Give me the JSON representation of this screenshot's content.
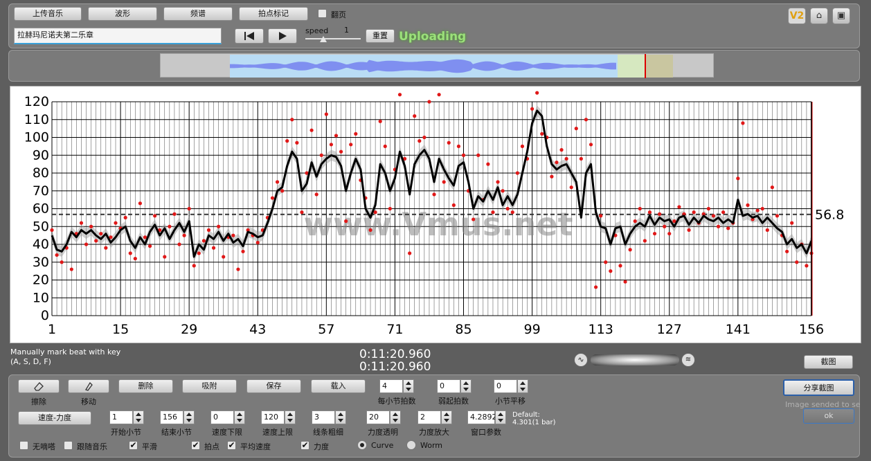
{
  "toolbar": {
    "upload_music": "上传音乐",
    "waveform": "波形",
    "spectrum": "频谱",
    "beat_mark": "拍点标记",
    "page_turn": "翻页",
    "song_title": "拉赫玛尼诺夫第二乐章",
    "speed_label": "speed",
    "speed_value": "1",
    "reset": "重置",
    "status": "Uploading",
    "v2_badge": "V2"
  },
  "info": {
    "hint_line1": "Manually mark beat with key",
    "hint_line2": "(A, S, D, F)",
    "time_current": "0:11:20.960",
    "time_total": "0:11:20.960",
    "screenshot": "截图",
    "share_screenshot": "分享截图",
    "sent_msg": "Image sended to sever",
    "ok": "ok"
  },
  "controls": {
    "erase": "擦除",
    "move": "移动",
    "delete": "删除",
    "snap": "吸附",
    "save": "保存",
    "load": "载入",
    "tempo_dynamics": "速度-力度",
    "beats_per_bar": {
      "value": "4",
      "label": "每小节拍数"
    },
    "pickup_beats": {
      "value": "0",
      "label": "弱起拍数"
    },
    "bar_shift": {
      "value": "0",
      "label": "小节平移"
    },
    "start_bar": {
      "value": "1",
      "label": "开始小节"
    },
    "end_bar": {
      "value": "156",
      "label": "结束小节"
    },
    "tempo_min": {
      "value": "0",
      "label": "速度下限"
    },
    "tempo_max": {
      "value": "120",
      "label": "速度上限"
    },
    "line_width": {
      "value": "3",
      "label": "线条粗细"
    },
    "dyn_opacity": {
      "value": "20",
      "label": "力度透明"
    },
    "dyn_scale": {
      "value": "2",
      "label": "力度放大"
    },
    "window_param": {
      "value": "4.2892",
      "label": "窗口参数"
    },
    "default_line1": "Default:",
    "default_line2": "4.301(1 bar)",
    "metronome": "无嘀嗒",
    "follow_music": "跟随音乐",
    "smooth": "平滑",
    "beat_points": "拍点",
    "avg_tempo": "平均速度",
    "dynamics": "力度",
    "curve": "Curve",
    "worm": "Worm"
  },
  "colors": {
    "bg": "#5e5e5e",
    "panel": "#7a7a7a",
    "accent_green": "#9be07a",
    "point_red": "#e01818",
    "curve_black": "#000000",
    "wave_blue": "#7f8ff0"
  },
  "chart_data": {
    "type": "scatter",
    "watermark": "www.Vmus.net",
    "xlim": [
      1,
      156
    ],
    "ylim": [
      0,
      120
    ],
    "xticks": [
      1,
      15,
      29,
      43,
      57,
      71,
      85,
      99,
      113,
      127,
      141,
      156
    ],
    "yticks": [
      0,
      10,
      20,
      30,
      40,
      50,
      60,
      70,
      80,
      90,
      100,
      110,
      120
    ],
    "average": 56.8,
    "average_label": "56.8",
    "curve": [
      [
        1,
        45
      ],
      [
        2,
        37
      ],
      [
        3,
        36
      ],
      [
        4,
        40
      ],
      [
        5,
        47
      ],
      [
        6,
        44
      ],
      [
        7,
        48
      ],
      [
        8,
        46
      ],
      [
        9,
        48
      ],
      [
        10,
        45
      ],
      [
        11,
        43
      ],
      [
        12,
        46
      ],
      [
        13,
        41
      ],
      [
        14,
        44
      ],
      [
        15,
        48
      ],
      [
        16,
        50
      ],
      [
        17,
        42
      ],
      [
        18,
        38
      ],
      [
        19,
        44
      ],
      [
        20,
        40
      ],
      [
        21,
        47
      ],
      [
        22,
        51
      ],
      [
        23,
        45
      ],
      [
        24,
        49
      ],
      [
        25,
        43
      ],
      [
        26,
        48
      ],
      [
        27,
        52
      ],
      [
        28,
        47
      ],
      [
        29,
        53
      ],
      [
        30,
        33
      ],
      [
        31,
        40
      ],
      [
        32,
        37
      ],
      [
        33,
        45
      ],
      [
        34,
        43
      ],
      [
        35,
        47
      ],
      [
        36,
        42
      ],
      [
        37,
        46
      ],
      [
        38,
        41
      ],
      [
        39,
        43
      ],
      [
        40,
        39
      ],
      [
        41,
        47
      ],
      [
        42,
        46
      ],
      [
        43,
        44
      ],
      [
        44,
        45
      ],
      [
        45,
        52
      ],
      [
        46,
        60
      ],
      [
        47,
        70
      ],
      [
        48,
        72
      ],
      [
        49,
        84
      ],
      [
        50,
        92
      ],
      [
        51,
        88
      ],
      [
        52,
        70
      ],
      [
        53,
        74
      ],
      [
        54,
        86
      ],
      [
        55,
        78
      ],
      [
        56,
        85
      ],
      [
        57,
        88
      ],
      [
        58,
        90
      ],
      [
        59,
        89
      ],
      [
        60,
        84
      ],
      [
        61,
        70
      ],
      [
        62,
        80
      ],
      [
        63,
        88
      ],
      [
        64,
        82
      ],
      [
        65,
        60
      ],
      [
        66,
        55
      ],
      [
        67,
        62
      ],
      [
        68,
        85
      ],
      [
        69,
        80
      ],
      [
        70,
        70
      ],
      [
        71,
        77
      ],
      [
        72,
        92
      ],
      [
        73,
        84
      ],
      [
        74,
        68
      ],
      [
        75,
        85
      ],
      [
        76,
        90
      ],
      [
        77,
        93
      ],
      [
        78,
        88
      ],
      [
        79,
        75
      ],
      [
        80,
        88
      ],
      [
        81,
        82
      ],
      [
        82,
        77
      ],
      [
        83,
        73
      ],
      [
        84,
        84
      ],
      [
        85,
        86
      ],
      [
        86,
        75
      ],
      [
        87,
        60
      ],
      [
        88,
        67
      ],
      [
        89,
        64
      ],
      [
        90,
        70
      ],
      [
        91,
        65
      ],
      [
        92,
        72
      ],
      [
        93,
        62
      ],
      [
        94,
        67
      ],
      [
        95,
        62
      ],
      [
        96,
        68
      ],
      [
        97,
        80
      ],
      [
        98,
        92
      ],
      [
        99,
        108
      ],
      [
        100,
        115
      ],
      [
        101,
        112
      ],
      [
        102,
        95
      ],
      [
        103,
        85
      ],
      [
        104,
        82
      ],
      [
        105,
        84
      ],
      [
        106,
        85
      ],
      [
        107,
        80
      ],
      [
        108,
        75
      ],
      [
        109,
        55
      ],
      [
        110,
        80
      ],
      [
        111,
        85
      ],
      [
        112,
        58
      ],
      [
        113,
        50
      ],
      [
        114,
        49
      ],
      [
        115,
        40
      ],
      [
        116,
        49
      ],
      [
        117,
        50
      ],
      [
        118,
        40
      ],
      [
        119,
        46
      ],
      [
        120,
        50
      ],
      [
        121,
        52
      ],
      [
        122,
        50
      ],
      [
        123,
        56
      ],
      [
        124,
        51
      ],
      [
        125,
        55
      ],
      [
        126,
        53
      ],
      [
        127,
        54
      ],
      [
        128,
        50
      ],
      [
        129,
        55
      ],
      [
        130,
        56
      ],
      [
        131,
        51
      ],
      [
        132,
        55
      ],
      [
        133,
        52
      ],
      [
        134,
        56
      ],
      [
        135,
        54
      ],
      [
        136,
        53
      ],
      [
        137,
        55
      ],
      [
        138,
        52
      ],
      [
        139,
        54
      ],
      [
        140,
        52
      ],
      [
        141,
        65
      ],
      [
        142,
        56
      ],
      [
        143,
        57
      ],
      [
        144,
        55
      ],
      [
        145,
        56
      ],
      [
        146,
        52
      ],
      [
        147,
        55
      ],
      [
        148,
        52
      ],
      [
        149,
        49
      ],
      [
        150,
        47
      ],
      [
        151,
        40
      ],
      [
        152,
        43
      ],
      [
        153,
        38
      ],
      [
        154,
        40
      ],
      [
        155,
        35
      ],
      [
        156,
        42
      ]
    ],
    "points": [
      [
        1,
        48
      ],
      [
        2,
        34
      ],
      [
        3,
        30
      ],
      [
        4,
        38
      ],
      [
        5,
        26
      ],
      [
        6,
        46
      ],
      [
        7,
        52
      ],
      [
        8,
        40
      ],
      [
        9,
        50
      ],
      [
        10,
        42
      ],
      [
        11,
        46
      ],
      [
        12,
        38
      ],
      [
        13,
        44
      ],
      [
        14,
        52
      ],
      [
        15,
        49
      ],
      [
        16,
        55
      ],
      [
        17,
        35
      ],
      [
        18,
        32
      ],
      [
        19,
        63
      ],
      [
        20,
        44
      ],
      [
        21,
        39
      ],
      [
        22,
        56
      ],
      [
        23,
        48
      ],
      [
        24,
        33
      ],
      [
        25,
        50
      ],
      [
        26,
        57
      ],
      [
        27,
        40
      ],
      [
        28,
        45
      ],
      [
        29,
        60
      ],
      [
        30,
        28
      ],
      [
        31,
        35
      ],
      [
        32,
        42
      ],
      [
        33,
        48
      ],
      [
        34,
        38
      ],
      [
        35,
        50
      ],
      [
        36,
        33
      ],
      [
        37,
        44
      ],
      [
        38,
        45
      ],
      [
        39,
        26
      ],
      [
        40,
        36
      ],
      [
        41,
        48
      ],
      [
        42,
        45
      ],
      [
        43,
        41
      ],
      [
        44,
        48
      ],
      [
        45,
        55
      ],
      [
        46,
        66
      ],
      [
        47,
        75
      ],
      [
        48,
        70
      ],
      [
        49,
        98
      ],
      [
        50,
        110
      ],
      [
        51,
        97
      ],
      [
        52,
        58
      ],
      [
        53,
        80
      ],
      [
        54,
        104
      ],
      [
        55,
        68
      ],
      [
        56,
        90
      ],
      [
        57,
        113
      ],
      [
        58,
        96
      ],
      [
        59,
        101
      ],
      [
        60,
        92
      ],
      [
        61,
        53
      ],
      [
        62,
        96
      ],
      [
        63,
        102
      ],
      [
        64,
        76
      ],
      [
        65,
        66
      ],
      [
        66,
        48
      ],
      [
        67,
        58
      ],
      [
        68,
        109
      ],
      [
        69,
        95
      ],
      [
        70,
        60
      ],
      [
        71,
        82
      ],
      [
        72,
        124
      ],
      [
        73,
        88
      ],
      [
        74,
        35
      ],
      [
        75,
        112
      ],
      [
        76,
        98
      ],
      [
        77,
        100
      ],
      [
        78,
        120
      ],
      [
        79,
        68
      ],
      [
        80,
        124
      ],
      [
        81,
        75
      ],
      [
        82,
        97
      ],
      [
        83,
        62
      ],
      [
        84,
        95
      ],
      [
        85,
        90
      ],
      [
        86,
        70
      ],
      [
        87,
        54
      ],
      [
        88,
        90
      ],
      [
        89,
        65
      ],
      [
        90,
        85
      ],
      [
        91,
        58
      ],
      [
        92,
        75
      ],
      [
        93,
        70
      ],
      [
        94,
        60
      ],
      [
        95,
        58
      ],
      [
        96,
        80
      ],
      [
        97,
        95
      ],
      [
        98,
        88
      ],
      [
        99,
        116
      ],
      [
        100,
        125
      ],
      [
        101,
        102
      ],
      [
        102,
        100
      ],
      [
        103,
        78
      ],
      [
        104,
        86
      ],
      [
        105,
        93
      ],
      [
        106,
        88
      ],
      [
        107,
        72
      ],
      [
        108,
        105
      ],
      [
        109,
        88
      ],
      [
        110,
        110
      ],
      [
        111,
        96
      ],
      [
        112,
        16
      ],
      [
        113,
        56
      ],
      [
        114,
        30
      ],
      [
        115,
        25
      ],
      [
        116,
        45
      ],
      [
        117,
        28
      ],
      [
        118,
        19
      ],
      [
        119,
        37
      ],
      [
        120,
        53
      ],
      [
        121,
        60
      ],
      [
        122,
        42
      ],
      [
        123,
        58
      ],
      [
        124,
        46
      ],
      [
        125,
        57
      ],
      [
        126,
        50
      ],
      [
        127,
        46
      ],
      [
        128,
        53
      ],
      [
        129,
        61
      ],
      [
        130,
        57
      ],
      [
        131,
        48
      ],
      [
        132,
        58
      ],
      [
        133,
        52
      ],
      [
        134,
        57
      ],
      [
        135,
        60
      ],
      [
        136,
        56
      ],
      [
        137,
        50
      ],
      [
        138,
        58
      ],
      [
        139,
        49
      ],
      [
        140,
        52
      ],
      [
        141,
        77
      ],
      [
        142,
        108
      ],
      [
        143,
        62
      ],
      [
        144,
        54
      ],
      [
        145,
        59
      ],
      [
        146,
        60
      ],
      [
        147,
        48
      ],
      [
        148,
        72
      ],
      [
        149,
        56
      ],
      [
        150,
        45
      ],
      [
        151,
        36
      ],
      [
        152,
        52
      ],
      [
        153,
        30
      ],
      [
        154,
        40
      ],
      [
        155,
        28
      ],
      [
        156,
        35
      ]
    ]
  }
}
